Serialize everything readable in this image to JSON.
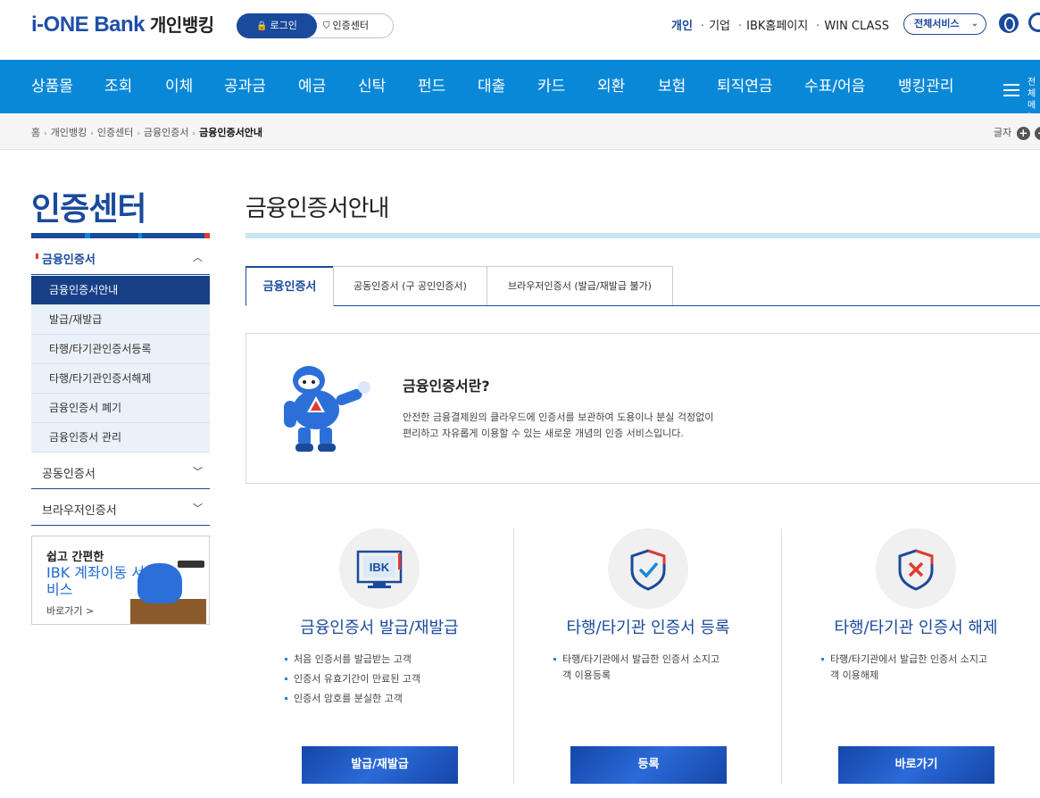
{
  "header": {
    "logo_prefix": "i-ONE Bank",
    "logo_sub": "개인뱅킹",
    "login_label": "로그인",
    "cert_center_label": "인증센터",
    "top_links": [
      "개인",
      "기업",
      "IBK홈페이지",
      "WIN CLASS"
    ],
    "all_services_label": "전체서비스"
  },
  "gnb": {
    "items": [
      "상품몰",
      "조회",
      "이체",
      "공과금",
      "예금",
      "신탁",
      "펀드",
      "대출",
      "카드",
      "외환",
      "보험",
      "퇴직연금",
      "수표/어음",
      "뱅킹관리"
    ],
    "menu_label": "전체메뉴"
  },
  "breadcrumb": {
    "items": [
      "홈",
      "개인뱅킹",
      "인증센터",
      "금융인증서",
      "금융인증서안내"
    ],
    "font_label": "글자"
  },
  "lnb": {
    "title": "인증센터",
    "groups": [
      {
        "label": "금융인증서",
        "open": true
      },
      {
        "label": "공동인증서",
        "open": false
      },
      {
        "label": "브라우저인증서",
        "open": false
      }
    ],
    "sub_items": [
      "금융인증서안내",
      "발급/재발급",
      "타행/타기관인증서등록",
      "타행/타기관인증서해제",
      "금융인증서 폐기",
      "금융인증서 관리"
    ],
    "active_sub": 0
  },
  "banner": {
    "line1": "쉽고 간편한",
    "line2": "IBK 계좌이동 서비스",
    "link": "바로가기 >"
  },
  "main": {
    "title": "금융인증서안내",
    "tabs": [
      "금융인증서",
      "공동인증서 (구 공인인증서)",
      "브라우저인증서 (발급/재발급 불가)"
    ],
    "active_tab": 0,
    "intro": {
      "question": "금융인증서란?",
      "desc1": "안전한 금융결제원의 클라우드에 인증서를 보관하여 도용이나 분실 걱정없이",
      "desc2": "편리하고 자유롭게 이용할 수 있는 새로운 개념의 인증 서비스입니다."
    },
    "cards": [
      {
        "title": "금융인증서 발급/재발급",
        "items": [
          "처음 인증서를 발급받는 고객",
          "인증서 유효기간이 만료된 고객",
          "인증서 암호를 분실한 고객"
        ],
        "button": "발급/재발급",
        "icon": "ibk-monitor-icon"
      },
      {
        "title": "타행/타기관 인증서 등록",
        "items": [
          "타행/타기관에서 발급한 인증서 소지고",
          "객 이용등록"
        ],
        "button": "등록",
        "icon": "shield-check-icon"
      },
      {
        "title": "타행/타기관 인증서 해제",
        "items": [
          "타행/타기관에서 발급한 인증서 소지고",
          "객 이용해제"
        ],
        "button": "바로가기",
        "icon": "shield-x-icon"
      }
    ]
  },
  "colors": {
    "brand_navy": "#1a4a9b",
    "gnb_blue": "#0a88d8",
    "accent_red": "#e23a2f"
  }
}
